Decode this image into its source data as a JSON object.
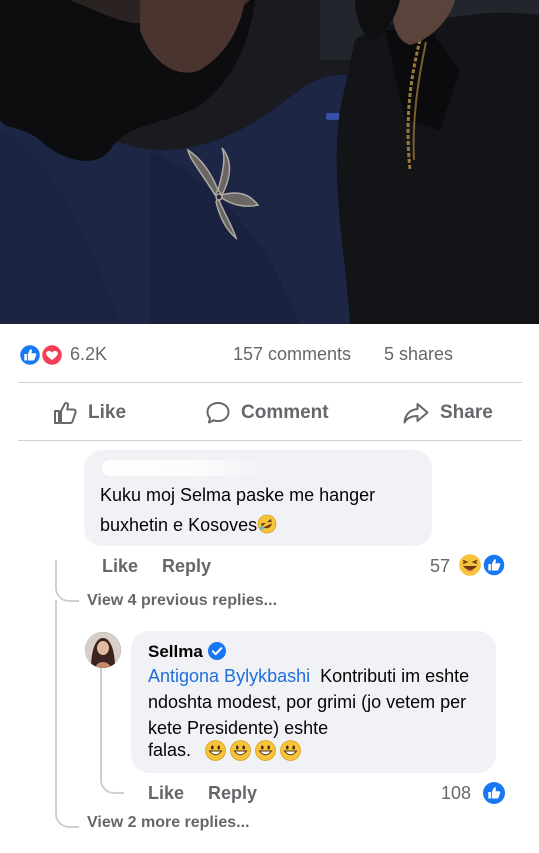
{
  "post": {
    "reactions_count": "6.2K",
    "comments_count": "157 comments",
    "shares_count": "5 shares",
    "reaction_icons": [
      "like-icon",
      "love-icon"
    ]
  },
  "actions": {
    "like": "Like",
    "comment": "Comment",
    "share": "Share"
  },
  "comments": [
    {
      "author": "",
      "text": "Kuku moj Selma paske me hanger buxhetin e Kosoves",
      "emoji": "rolling-on-floor-laughing-emoji",
      "like_label": "Like",
      "reply_label": "Reply",
      "reactions_count": "57",
      "reaction_icons": [
        "haha-icon",
        "like-icon"
      ],
      "view_previous_replies": "View 4 previous replies..."
    },
    {
      "author": "Sellma",
      "verified": true,
      "mention": "Antigona Bylykbashi",
      "text": "Kontributi im eshte ndoshta modest, por grimi (jo vetem per kete Presidente) eshte",
      "text_end": "falas.",
      "emoji": "grinning-face-emoji",
      "emoji_count": 4,
      "like_label": "Like",
      "reply_label": "Reply",
      "reactions_count": "108",
      "reaction_icons": [
        "like-icon"
      ],
      "view_more_replies": "View 2 more replies..."
    }
  ],
  "colors": {
    "accent": "#1877f2",
    "mention": "#216fdb",
    "love": "#f33e58",
    "muted_text": "#65676b",
    "bubble_bg": "#f0f2f5"
  }
}
